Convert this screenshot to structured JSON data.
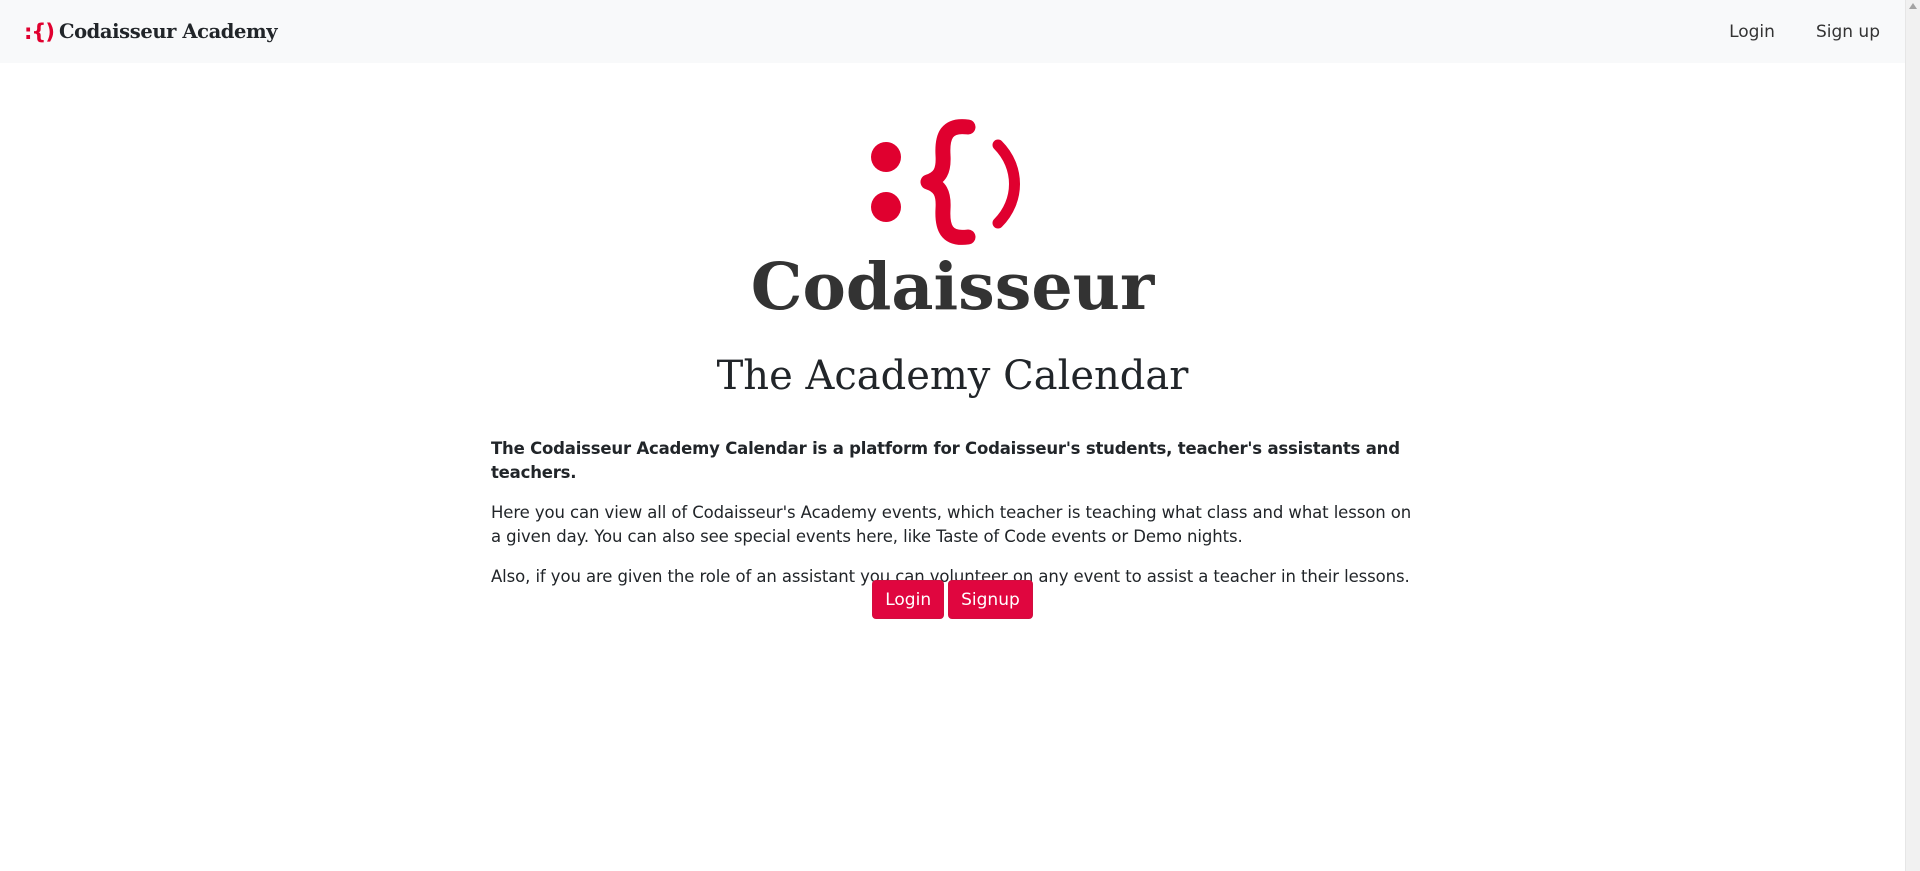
{
  "navbar": {
    "logo_glyph": ":{)",
    "brand": "Codaisseur Academy",
    "links": [
      {
        "label": "Login"
      },
      {
        "label": "Sign up"
      }
    ]
  },
  "hero": {
    "name": "Codaisseur",
    "title": "The Academy Calendar"
  },
  "content": {
    "intro": "The Codaisseur Academy Calendar is a platform for Codaisseur's students, teacher's assistants and teachers.",
    "paragraph1": "Here you can view all of Codaisseur's Academy events, which teacher is teaching what class and what lesson on a given day. You can also see special events here, like Taste of Code events or Demo nights.",
    "paragraph2": "Also, if you are given the role of an assistant you can volunteer on any event to assist a teacher in their lessons."
  },
  "actions": {
    "login_label": "Login",
    "signup_label": "Signup"
  },
  "colors": {
    "brand_red": "#e0002f",
    "button_red": "#e0063f",
    "navbar_bg": "#f8f9fa"
  }
}
